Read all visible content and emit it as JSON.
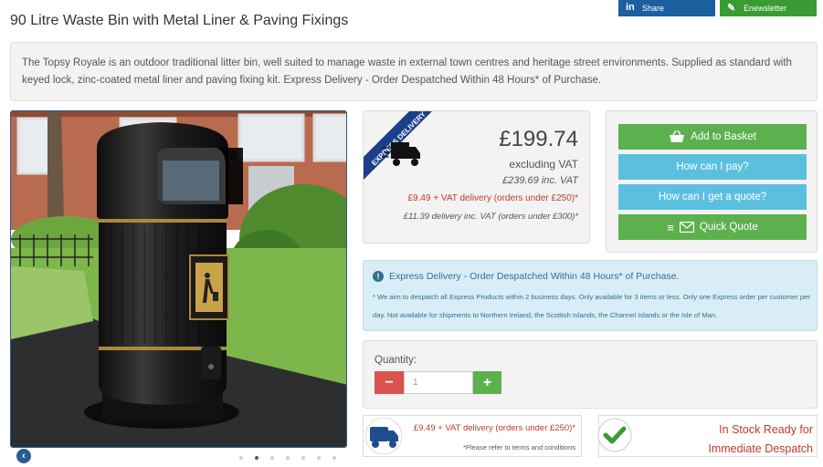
{
  "share": {
    "share_label": "Share",
    "newsletter_label": "Enewsletter"
  },
  "product": {
    "title": "90 Litre Waste Bin with Metal Liner & Paving Fixings",
    "description": "The Topsy Royale is an outdoor traditional litter bin, well suited to manage waste in external town centres and heritage street environments. Supplied as standard with keyed lock, zinc-coated metal liner and paving fixing kit. Express Delivery - Order Despatched Within 48 Hours* of Purchase."
  },
  "price": {
    "banner": "EXPRESS DELIVERY",
    "amount": "£199.74",
    "ex_vat_label": "excluding VAT",
    "inc_vat": "£239.69 inc. VAT",
    "delivery": "£9.49 + VAT delivery (orders under £250)*",
    "delivery_inc": "£11.39 delivery inc. VAT (orders under £300)*"
  },
  "actions": {
    "add_to_basket": "Add to Basket",
    "how_pay": "How can I pay?",
    "how_quote": "How can I get a quote?",
    "quick_quote": "Quick Quote"
  },
  "express": {
    "title": "Express Delivery - Order Despatched Within 48 Hours* of Purchase.",
    "note": "* We aim to despatch all Express Products within 2 business days. Only available for 3 items or less. Only one Express order per customer per day. Not available for shipments to Northern Ireland, the Scottish Islands, the Channel Islands or the Isle of Man."
  },
  "quantity": {
    "label": "Quantity:",
    "value": "1",
    "minus": "−",
    "plus": "+"
  },
  "delivery_panel": {
    "text": "£9.49 + VAT delivery (orders under £250)*",
    "terms": "*Please refer to terms and conditions"
  },
  "stock": {
    "text": "In Stock Ready for Immediate Despatch"
  },
  "carousel": {
    "slide_count": 7,
    "active_index": 1
  },
  "icons": [
    "linkedin-icon",
    "newsletter-icon",
    "basket-icon",
    "menu-icon",
    "envelope-icon",
    "truck-icon",
    "info-icon",
    "check-icon",
    "chevron-left-icon"
  ],
  "colors": {
    "green": "#5cb14e",
    "blue": "#5bc0de",
    "navy": "#1b5f9e",
    "red": "#d9534f",
    "price_red": "#c0392b"
  }
}
